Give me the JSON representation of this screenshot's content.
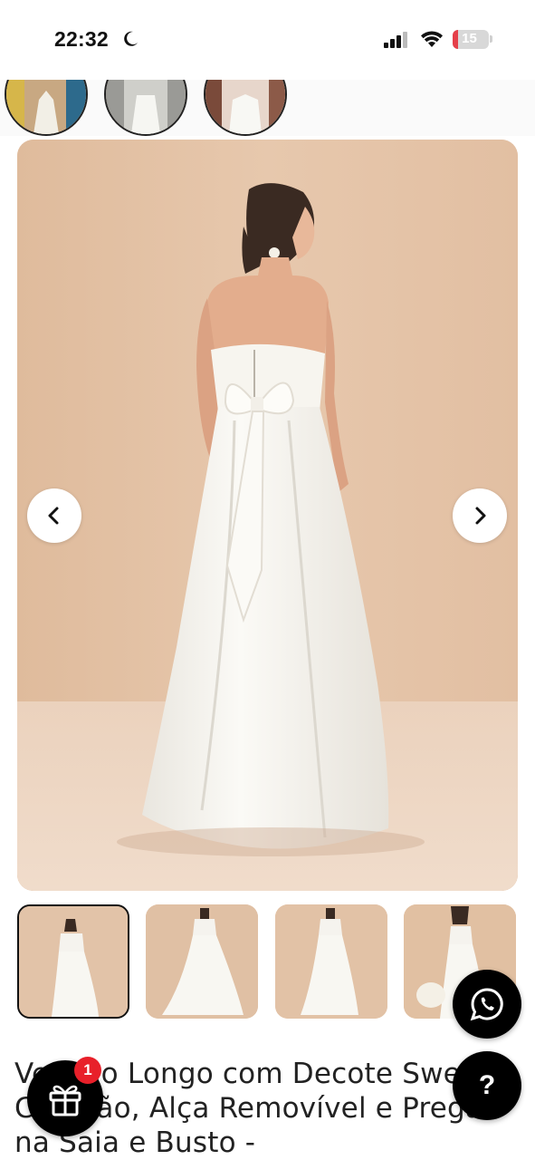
{
  "status_bar": {
    "time": "22:32",
    "battery_level": "15",
    "battery_color": "#e5404a"
  },
  "stories": [
    {
      "label": "story-1"
    },
    {
      "label": "story-2"
    },
    {
      "label": "story-3"
    }
  ],
  "gallery": {
    "prev_icon": "chevron-left-icon",
    "next_icon": "chevron-right-icon",
    "thumbnail_count": 4,
    "selected_index": 0
  },
  "product": {
    "title": "Vestido Longo com Decote Sweet Coração, Alça Removível e Pregas na Saia e Busto -"
  },
  "floating": {
    "whatsapp_icon": "whatsapp-icon",
    "help_label": "?",
    "gift_icon": "gift-icon",
    "gift_badge": "1"
  },
  "colors": {
    "background_beige": "#e4c4a8",
    "dress_white": "#f7f5ef",
    "fab": "#000000",
    "badge": "#e8202a"
  }
}
